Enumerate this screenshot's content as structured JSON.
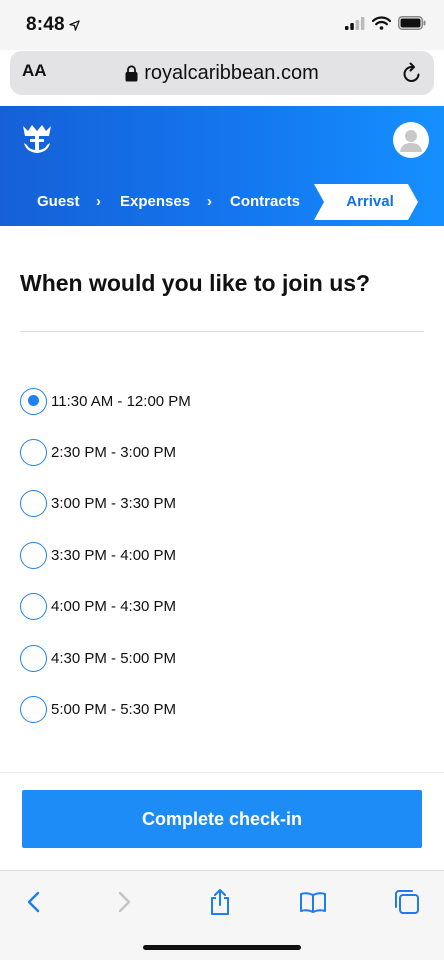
{
  "status_bar": {
    "time": "8:48"
  },
  "browser": {
    "text_size_label": "AA",
    "url": "royalcaribbean.com"
  },
  "breadcrumb": {
    "items": [
      "Guest",
      "Expenses",
      "Contracts",
      "Arrival"
    ],
    "active_index": 3
  },
  "main": {
    "question": "When would you like to join us?",
    "selected_index": 0,
    "options": [
      "11:30 AM - 12:00 PM",
      "2:30 PM - 3:00 PM",
      "3:00 PM - 3:30 PM",
      "3:30 PM - 4:00 PM",
      "4:00 PM - 4:30 PM",
      "4:30 PM - 5:00 PM",
      "5:00 PM - 5:30 PM"
    ],
    "submit_label": "Complete check-in"
  },
  "colors": {
    "brand_blue": "#1477ef",
    "accent_blue": "#1e8cf7"
  }
}
